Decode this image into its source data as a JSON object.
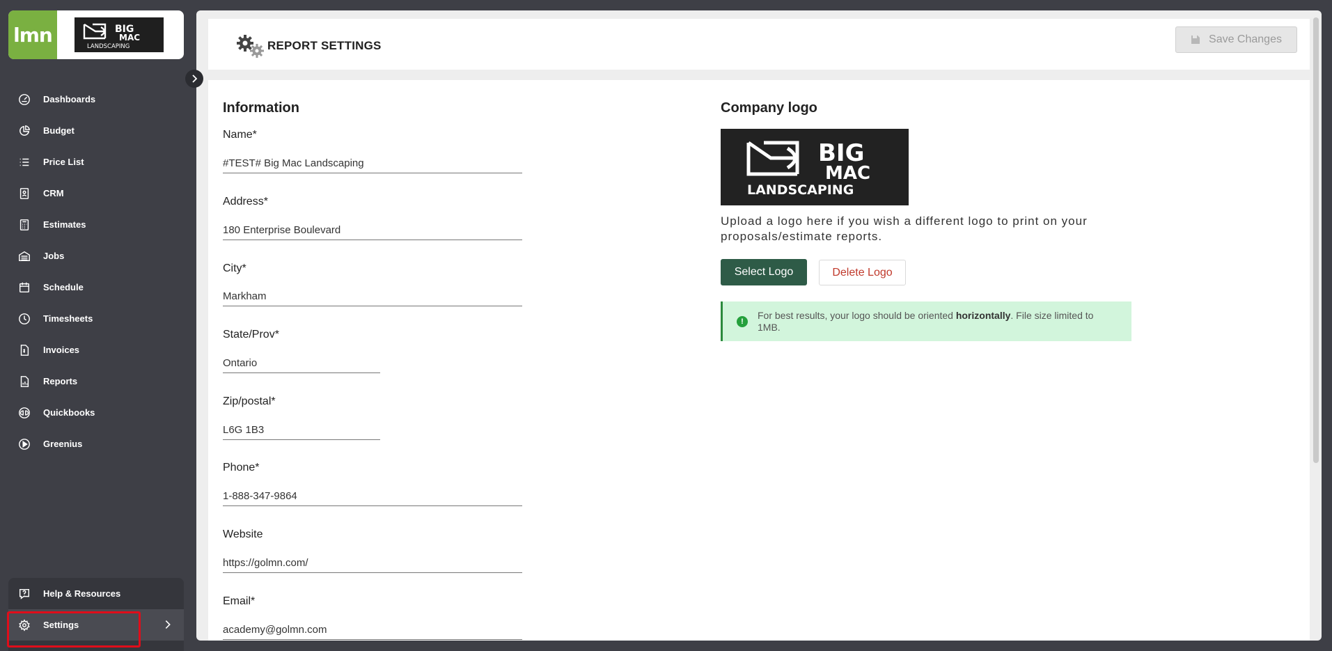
{
  "brand": {
    "app_logo_text": "lmn",
    "client_logo_lines": [
      "BIG",
      "MAC",
      "LANDSCAPING"
    ]
  },
  "sidebar": {
    "items": [
      {
        "label": "Dashboards",
        "icon": "dashboard-icon"
      },
      {
        "label": "Budget",
        "icon": "pie-chart-icon"
      },
      {
        "label": "Price List",
        "icon": "list-icon"
      },
      {
        "label": "CRM",
        "icon": "contact-card-icon"
      },
      {
        "label": "Estimates",
        "icon": "calculator-icon"
      },
      {
        "label": "Jobs",
        "icon": "garage-icon"
      },
      {
        "label": "Schedule",
        "icon": "calendar-icon"
      },
      {
        "label": "Timesheets",
        "icon": "clock-icon"
      },
      {
        "label": "Invoices",
        "icon": "invoice-icon"
      },
      {
        "label": "Reports",
        "icon": "report-icon"
      },
      {
        "label": "Quickbooks",
        "icon": "quickbooks-icon"
      },
      {
        "label": "Greenius",
        "icon": "play-circle-icon"
      }
    ],
    "help_label": "Help & Resources",
    "settings_label": "Settings"
  },
  "header": {
    "title": "REPORT SETTINGS",
    "save_label": "Save Changes"
  },
  "information": {
    "title": "Information",
    "fields": [
      {
        "label": "Name*",
        "value": "#TEST# Big Mac Landscaping"
      },
      {
        "label": "Address*",
        "value": "180 Enterprise Boulevard"
      },
      {
        "label": "City*",
        "value": "Markham"
      },
      {
        "label": "State/Prov*",
        "value": "Ontario"
      },
      {
        "label": "Zip/postal*",
        "value": "L6G 1B3"
      },
      {
        "label": "Phone*",
        "value": "1-888-347-9864"
      },
      {
        "label": "Website",
        "value": "https://golmn.com/"
      },
      {
        "label": "Email*",
        "value": "academy@golmn.com"
      }
    ]
  },
  "company_logo": {
    "title": "Company logo",
    "logo_lines": [
      "BIG",
      "MAC",
      "LANDSCAPING"
    ],
    "description": "Upload a logo here if you wish a different logo to print on your proposals/estimate reports.",
    "select_label": "Select Logo",
    "delete_label": "Delete Logo",
    "alert_pre": "For best results, your logo should be oriented ",
    "alert_bold": "horizontally",
    "alert_post": ". File size limited to 1MB."
  },
  "colors": {
    "sidebar_bg": "#3e3f46",
    "brand_green": "#7ab041",
    "primary_button": "#2e5b47",
    "danger_text": "#c0392b",
    "alert_bg": "#d2f5dc",
    "highlight": "#e00d1a"
  }
}
